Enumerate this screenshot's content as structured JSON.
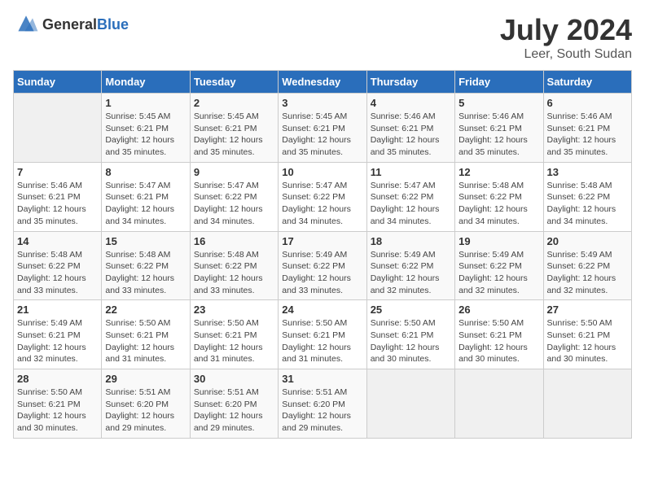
{
  "header": {
    "logo_general": "General",
    "logo_blue": "Blue",
    "title": "July 2024",
    "subtitle": "Leer, South Sudan"
  },
  "days_of_week": [
    "Sunday",
    "Monday",
    "Tuesday",
    "Wednesday",
    "Thursday",
    "Friday",
    "Saturday"
  ],
  "weeks": [
    [
      {
        "day": "",
        "info": ""
      },
      {
        "day": "1",
        "info": "Sunrise: 5:45 AM\nSunset: 6:21 PM\nDaylight: 12 hours and 35 minutes."
      },
      {
        "day": "2",
        "info": "Sunrise: 5:45 AM\nSunset: 6:21 PM\nDaylight: 12 hours and 35 minutes."
      },
      {
        "day": "3",
        "info": "Sunrise: 5:45 AM\nSunset: 6:21 PM\nDaylight: 12 hours and 35 minutes."
      },
      {
        "day": "4",
        "info": "Sunrise: 5:46 AM\nSunset: 6:21 PM\nDaylight: 12 hours and 35 minutes."
      },
      {
        "day": "5",
        "info": "Sunrise: 5:46 AM\nSunset: 6:21 PM\nDaylight: 12 hours and 35 minutes."
      },
      {
        "day": "6",
        "info": "Sunrise: 5:46 AM\nSunset: 6:21 PM\nDaylight: 12 hours and 35 minutes."
      }
    ],
    [
      {
        "day": "7",
        "info": "Sunrise: 5:46 AM\nSunset: 6:21 PM\nDaylight: 12 hours and 35 minutes."
      },
      {
        "day": "8",
        "info": "Sunrise: 5:47 AM\nSunset: 6:21 PM\nDaylight: 12 hours and 34 minutes."
      },
      {
        "day": "9",
        "info": "Sunrise: 5:47 AM\nSunset: 6:22 PM\nDaylight: 12 hours and 34 minutes."
      },
      {
        "day": "10",
        "info": "Sunrise: 5:47 AM\nSunset: 6:22 PM\nDaylight: 12 hours and 34 minutes."
      },
      {
        "day": "11",
        "info": "Sunrise: 5:47 AM\nSunset: 6:22 PM\nDaylight: 12 hours and 34 minutes."
      },
      {
        "day": "12",
        "info": "Sunrise: 5:48 AM\nSunset: 6:22 PM\nDaylight: 12 hours and 34 minutes."
      },
      {
        "day": "13",
        "info": "Sunrise: 5:48 AM\nSunset: 6:22 PM\nDaylight: 12 hours and 34 minutes."
      }
    ],
    [
      {
        "day": "14",
        "info": "Sunrise: 5:48 AM\nSunset: 6:22 PM\nDaylight: 12 hours and 33 minutes."
      },
      {
        "day": "15",
        "info": "Sunrise: 5:48 AM\nSunset: 6:22 PM\nDaylight: 12 hours and 33 minutes."
      },
      {
        "day": "16",
        "info": "Sunrise: 5:48 AM\nSunset: 6:22 PM\nDaylight: 12 hours and 33 minutes."
      },
      {
        "day": "17",
        "info": "Sunrise: 5:49 AM\nSunset: 6:22 PM\nDaylight: 12 hours and 33 minutes."
      },
      {
        "day": "18",
        "info": "Sunrise: 5:49 AM\nSunset: 6:22 PM\nDaylight: 12 hours and 32 minutes."
      },
      {
        "day": "19",
        "info": "Sunrise: 5:49 AM\nSunset: 6:22 PM\nDaylight: 12 hours and 32 minutes."
      },
      {
        "day": "20",
        "info": "Sunrise: 5:49 AM\nSunset: 6:22 PM\nDaylight: 12 hours and 32 minutes."
      }
    ],
    [
      {
        "day": "21",
        "info": "Sunrise: 5:49 AM\nSunset: 6:21 PM\nDaylight: 12 hours and 32 minutes."
      },
      {
        "day": "22",
        "info": "Sunrise: 5:50 AM\nSunset: 6:21 PM\nDaylight: 12 hours and 31 minutes."
      },
      {
        "day": "23",
        "info": "Sunrise: 5:50 AM\nSunset: 6:21 PM\nDaylight: 12 hours and 31 minutes."
      },
      {
        "day": "24",
        "info": "Sunrise: 5:50 AM\nSunset: 6:21 PM\nDaylight: 12 hours and 31 minutes."
      },
      {
        "day": "25",
        "info": "Sunrise: 5:50 AM\nSunset: 6:21 PM\nDaylight: 12 hours and 30 minutes."
      },
      {
        "day": "26",
        "info": "Sunrise: 5:50 AM\nSunset: 6:21 PM\nDaylight: 12 hours and 30 minutes."
      },
      {
        "day": "27",
        "info": "Sunrise: 5:50 AM\nSunset: 6:21 PM\nDaylight: 12 hours and 30 minutes."
      }
    ],
    [
      {
        "day": "28",
        "info": "Sunrise: 5:50 AM\nSunset: 6:21 PM\nDaylight: 12 hours and 30 minutes."
      },
      {
        "day": "29",
        "info": "Sunrise: 5:51 AM\nSunset: 6:20 PM\nDaylight: 12 hours and 29 minutes."
      },
      {
        "day": "30",
        "info": "Sunrise: 5:51 AM\nSunset: 6:20 PM\nDaylight: 12 hours and 29 minutes."
      },
      {
        "day": "31",
        "info": "Sunrise: 5:51 AM\nSunset: 6:20 PM\nDaylight: 12 hours and 29 minutes."
      },
      {
        "day": "",
        "info": ""
      },
      {
        "day": "",
        "info": ""
      },
      {
        "day": "",
        "info": ""
      }
    ]
  ]
}
